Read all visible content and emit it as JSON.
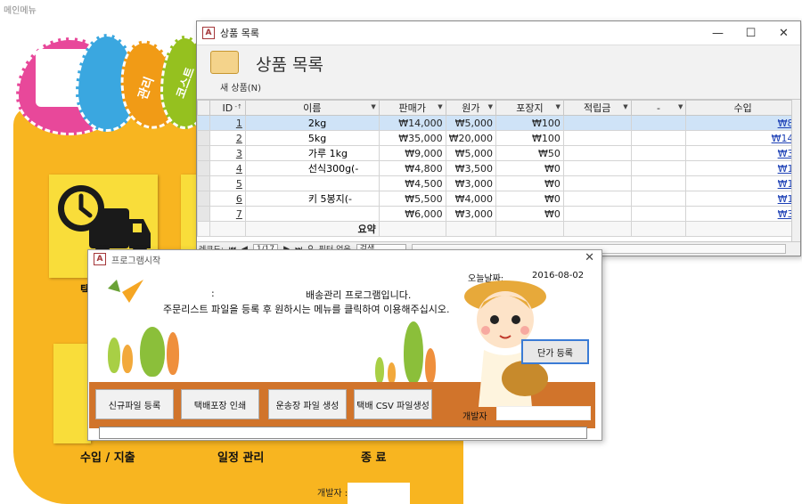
{
  "main_menu": {
    "title": "메인메뉴",
    "leaf_labels": [
      "관리",
      "코스트"
    ],
    "captions": {
      "income": "수입 / 지출",
      "schedule": "일정 관리",
      "exit": "종 료",
      "partial": "택"
    },
    "developer_label": "개발자 :"
  },
  "product_window": {
    "app_icon": "A",
    "title": "상품 목록",
    "header_title": "상품 목록",
    "new_product": "새 상품(N)",
    "columns": [
      "ID",
      "이름",
      "판매가",
      "원가",
      "포장지",
      "적립금",
      "-",
      "수입"
    ],
    "rows": [
      {
        "id": "1",
        "name": "2kg",
        "price": "₩14,000",
        "cost": "₩5,000",
        "wrap": "₩100",
        "income": "₩8,"
      },
      {
        "id": "2",
        "name": "5kg",
        "price": "₩35,000",
        "cost": "₩20,000",
        "wrap": "₩100",
        "income": "₩14,"
      },
      {
        "id": "3",
        "name": "가루 1kg",
        "price": "₩9,000",
        "cost": "₩5,000",
        "wrap": "₩50",
        "income": "₩3,"
      },
      {
        "id": "4",
        "name": "선식300g(-",
        "price": "₩4,800",
        "cost": "₩3,500",
        "wrap": "₩0",
        "income": "₩1,"
      },
      {
        "id": "5",
        "name": "",
        "price": "₩4,500",
        "cost": "₩3,000",
        "wrap": "₩0",
        "income": "₩1,"
      },
      {
        "id": "6",
        "name": "키 5봉지(-",
        "price": "₩5,500",
        "cost": "₩4,000",
        "wrap": "₩0",
        "income": "₩1,"
      },
      {
        "id": "7",
        "name": "",
        "price": "₩6,000",
        "cost": "₩3,000",
        "wrap": "₩0",
        "income": "₩3,"
      }
    ],
    "summary_label": "요약",
    "nav": {
      "record_label": "레코드:",
      "position": "1/17",
      "filter": "필터 없음",
      "search": "검색"
    }
  },
  "start_window": {
    "app_icon": "A",
    "title": "프로그램시작",
    "today_label": "오늘날짜:",
    "today_value": "2016-08-02",
    "colon": ":",
    "message_line1": "배송관리 프로그램입니다.",
    "message_line2": "주문리스트 파일을 등록 후 원하시는 메뉴를 클릭하여 이용해주십시오.",
    "buttons": {
      "unit_price": "단가 등록",
      "new_file": "신규파일 등록",
      "print_label": "택배포장 인쇄",
      "waybill": "운송장 파일 생성",
      "csv": "택배 CSV 파일생성"
    },
    "developer_label": "개발자",
    "status_value": ""
  },
  "colors": {
    "accent_blue": "#3a7bd5",
    "menu_yellow": "#f8b520",
    "tile_yellow": "#f9dd3a",
    "access_red": "#a4373a",
    "row_select": "#cfe3f7",
    "link_blue": "#1b3fb5"
  }
}
